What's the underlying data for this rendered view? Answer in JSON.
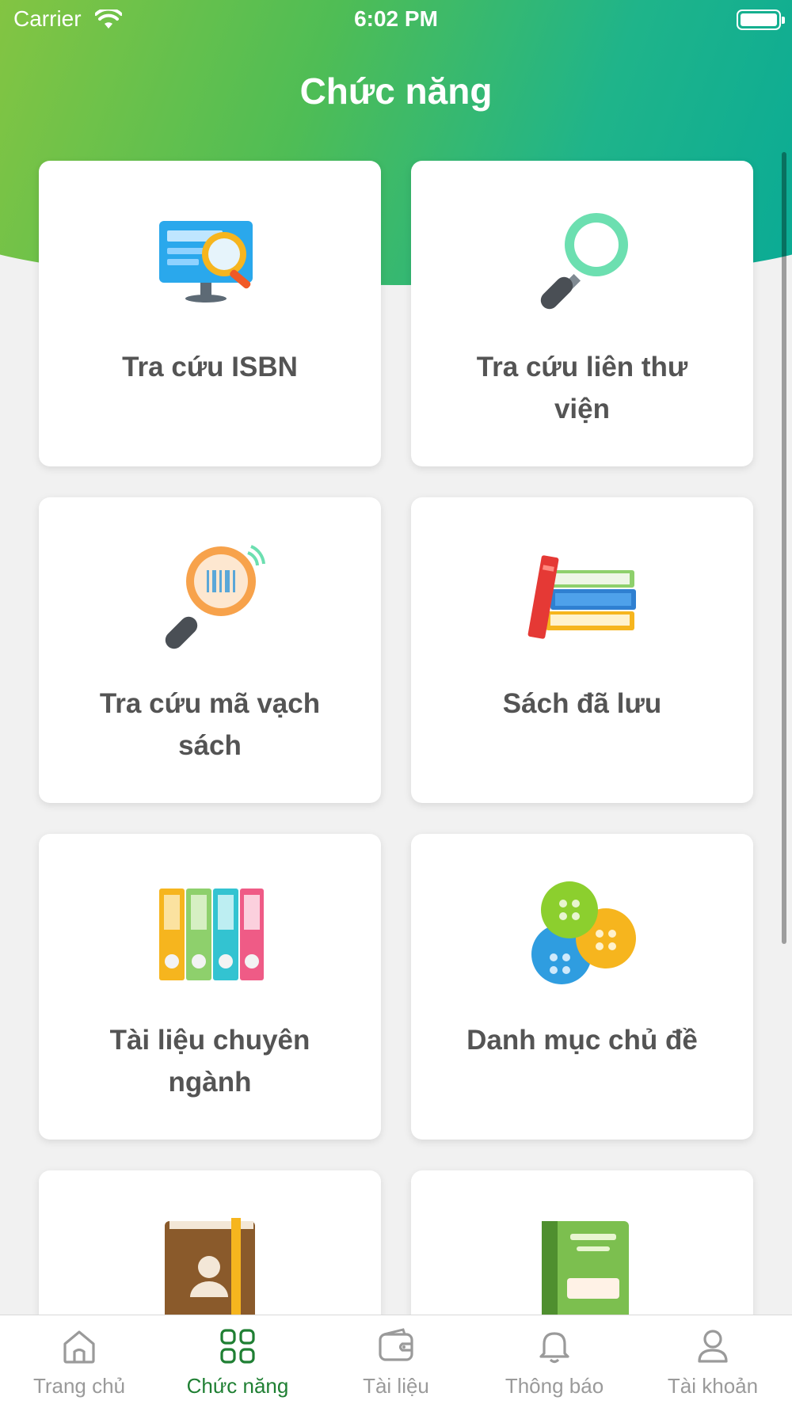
{
  "status_bar": {
    "carrier": "Carrier",
    "time": "6:02 PM"
  },
  "header": {
    "title": "Chức năng"
  },
  "cards": [
    {
      "label": "Tra cứu ISBN",
      "icon": "isbn-search-monitor-icon"
    },
    {
      "label": "Tra cứu liên thư viện",
      "icon": "magnifier-icon"
    },
    {
      "label": "Tra cứu mã vạch sách",
      "icon": "barcode-magnifier-icon"
    },
    {
      "label": "Sách đã lưu",
      "icon": "book-stack-icon"
    },
    {
      "label": "Tài liệu chuyên ngành",
      "icon": "binders-icon"
    },
    {
      "label": "Danh mục chủ đề",
      "icon": "buttons-icon"
    },
    {
      "label": "",
      "icon": "contact-book-icon"
    },
    {
      "label": "",
      "icon": "green-book-icon"
    }
  ],
  "tabbar": {
    "items": [
      {
        "label": "Trang chủ",
        "icon": "home-icon",
        "active": false
      },
      {
        "label": "Chức năng",
        "icon": "grid-icon",
        "active": true
      },
      {
        "label": "Tài liệu",
        "icon": "wallet-icon",
        "active": false
      },
      {
        "label": "Thông báo",
        "icon": "bell-icon",
        "active": false
      },
      {
        "label": "Tài khoản",
        "icon": "user-icon",
        "active": false
      }
    ]
  },
  "colors": {
    "header_start": "#8cc63f",
    "header_end": "#06a997",
    "active_tab": "#1f7f33",
    "inactive_tab": "#9a9a9a",
    "card_text": "#545454"
  }
}
